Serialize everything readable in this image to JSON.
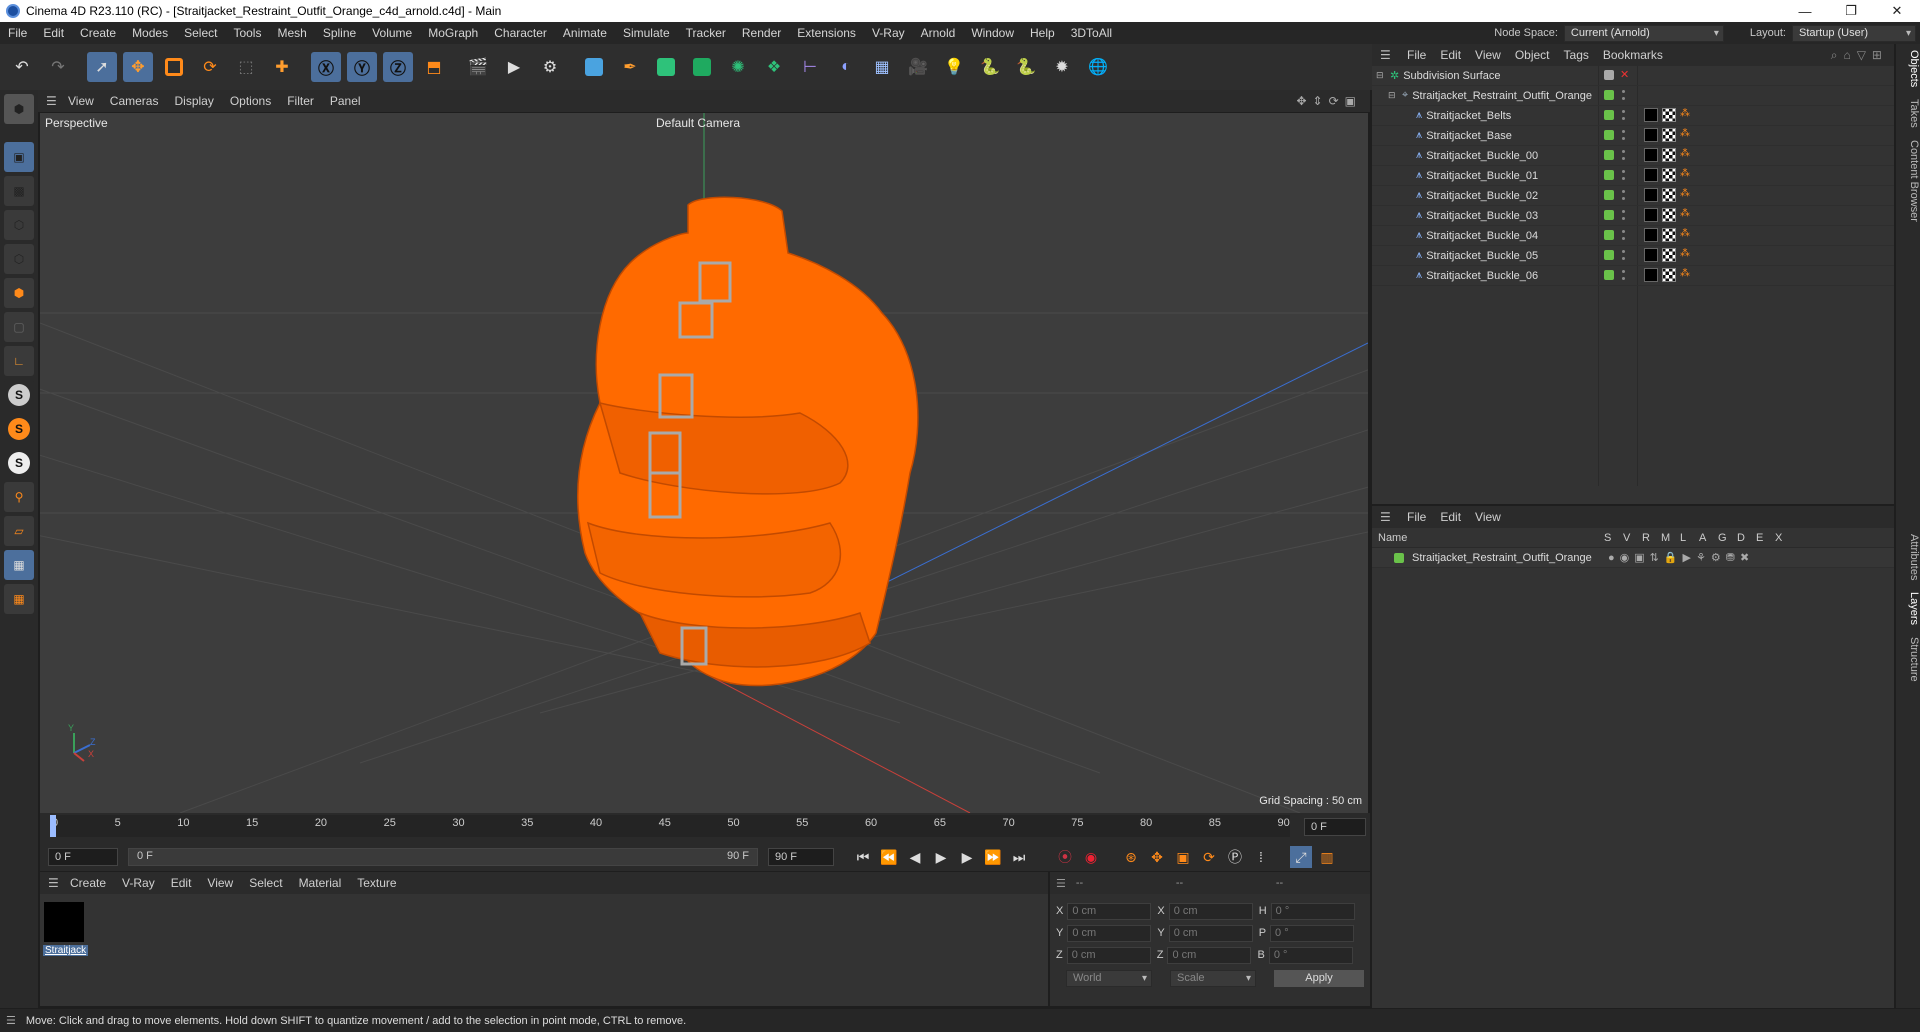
{
  "window": {
    "title": "Cinema 4D R23.110 (RC) - [Straitjacket_Restraint_Outfit_Orange_c4d_arnold.c4d] - Main"
  },
  "menu": [
    "File",
    "Edit",
    "Create",
    "Modes",
    "Select",
    "Tools",
    "Mesh",
    "Spline",
    "Volume",
    "MoGraph",
    "Character",
    "Animate",
    "Simulate",
    "Tracker",
    "Render",
    "Extensions",
    "V-Ray",
    "Arnold",
    "Window",
    "Help",
    "3DToAll"
  ],
  "nodespace": {
    "label": "Node Space:",
    "value": "Current (Arnold)"
  },
  "layout": {
    "label": "Layout:",
    "value": "Startup (User)"
  },
  "viewport": {
    "menu": [
      "View",
      "Cameras",
      "Display",
      "Options",
      "Filter",
      "Panel"
    ],
    "name": "Perspective",
    "camera": "Default Camera",
    "grid": "Grid Spacing : 50 cm",
    "axis": {
      "y": "Y",
      "z": "Z",
      "x": "X"
    }
  },
  "timeline": {
    "ticks": [
      "0",
      "5",
      "10",
      "15",
      "20",
      "25",
      "30",
      "35",
      "40",
      "45",
      "50",
      "55",
      "60",
      "65",
      "70",
      "75",
      "80",
      "85",
      "90"
    ],
    "current": "0 F",
    "start": "0 F",
    "range_start": "0 F",
    "range_end": "90 F",
    "end": "90 F"
  },
  "material": {
    "menu": [
      "Create",
      "V-Ray",
      "Edit",
      "View",
      "Select",
      "Material",
      "Texture"
    ],
    "item": "Straitjack"
  },
  "coords": {
    "rows": [
      {
        "a": "X",
        "av": "0 cm",
        "b": "X",
        "bv": "0 cm",
        "c": "H",
        "cv": "0 °"
      },
      {
        "a": "Y",
        "av": "0 cm",
        "b": "Y",
        "bv": "0 cm",
        "c": "P",
        "cv": "0 °"
      },
      {
        "a": "Z",
        "av": "0 cm",
        "b": "Z",
        "bv": "0 cm",
        "c": "B",
        "cv": "0 °"
      }
    ],
    "head1": "--",
    "head2": "--",
    "head3": "--",
    "world": "World",
    "scale": "Scale",
    "apply": "Apply"
  },
  "objects": {
    "menu": [
      "File",
      "Edit",
      "View",
      "Object",
      "Tags",
      "Bookmarks"
    ],
    "root": "Subdivision Surface",
    "group": "Straitjacket_Restraint_Outfit_Orange",
    "items": [
      "Straitjacket_Belts",
      "Straitjacket_Base",
      "Straitjacket_Buckle_00",
      "Straitjacket_Buckle_01",
      "Straitjacket_Buckle_02",
      "Straitjacket_Buckle_03",
      "Straitjacket_Buckle_04",
      "Straitjacket_Buckle_05",
      "Straitjacket_Buckle_06"
    ]
  },
  "layers": {
    "menu": [
      "File",
      "Edit",
      "View"
    ],
    "cols": [
      "Name",
      "S",
      "V",
      "R",
      "M",
      "L",
      "A",
      "G",
      "D",
      "E",
      "X"
    ],
    "item": "Straitjacket_Restraint_Outfit_Orange"
  },
  "sidetabs": [
    "Objects",
    "Takes",
    "Content Browser",
    "Attributes",
    "Layers",
    "Structure"
  ],
  "status": "Move: Click and drag to move elements. Hold down SHIFT to quantize movement / add to the selection in point mode, CTRL to remove.",
  "colors": {
    "accent": "#4c6f9c",
    "object": "#ff6a00",
    "green": "#6ac24a"
  }
}
